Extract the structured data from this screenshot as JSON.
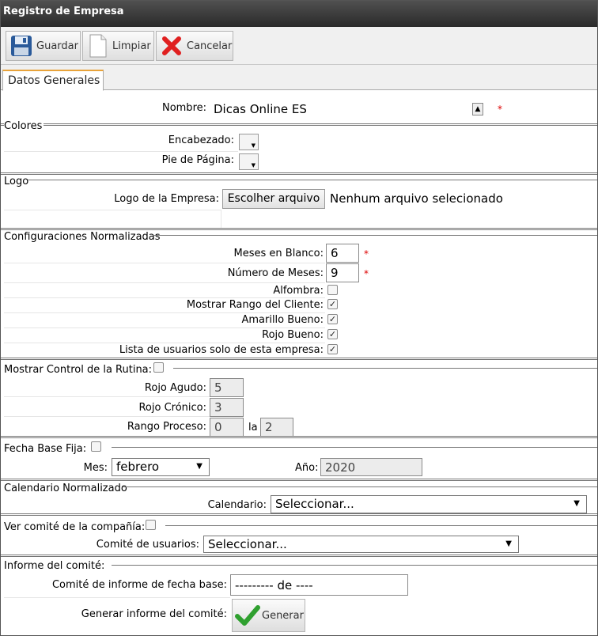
{
  "window": {
    "title": "Registro de Empresa"
  },
  "toolbar": {
    "save_label": "Guardar",
    "clear_label": "Limpiar",
    "cancel_label": "Cancelar"
  },
  "tabs": [
    {
      "label": "Datos Generales"
    }
  ],
  "nombre": {
    "label": "Nombre:",
    "value": "Dicas Online ES"
  },
  "colores": {
    "title": "Colores",
    "header_label": "Encabezado:",
    "footer_label": "Pie de Página:"
  },
  "logo": {
    "title": "Logo",
    "label": "Logo de la Empresa:",
    "button": "Escolher arquivo",
    "status": "Nenhum arquivo selecionado"
  },
  "config": {
    "title": "Configuraciones Normalizadas",
    "blank_months_label": "Meses en Blanco:",
    "blank_months_value": "6",
    "num_months_label": "Número de Meses:",
    "num_months_value": "9",
    "carpet_label": "Alfombra:",
    "client_range_label": "Mostrar Rango del Cliente:",
    "yellow_good_label": "Amarillo Bueno:",
    "red_good_label": "Rojo Bueno:",
    "company_users_label": "Lista de usuarios solo de esta empresa:"
  },
  "routine": {
    "title": "Mostrar Control de la Rutina:",
    "acute_label": "Rojo Agudo:",
    "acute_value": "5",
    "chronic_label": "Rojo Crónico:",
    "chronic_value": "3",
    "range_label": "Rango Proceso:",
    "range_from": "0",
    "range_sep": "la",
    "range_to": "2"
  },
  "base_date": {
    "title": "Fecha Base Fija:",
    "month_label": "Mes:",
    "month_value": "febrero",
    "year_label": "Año:",
    "year_value": "2020"
  },
  "calendar": {
    "title": "Calendario Normalizado",
    "label": "Calendario:",
    "value": "Seleccionar..."
  },
  "committee": {
    "title": "Ver comité de la compañía:",
    "label": "Comité de usuarios:",
    "value": "Seleccionar..."
  },
  "report": {
    "title": "Informe del comité:",
    "base_date_label": "Comité de informe de fecha base:",
    "base_date_value": "--------- de ----",
    "generate_label": "Generar informe del comité:",
    "generate_button": "Generar"
  },
  "required_marker": "*",
  "check_mark": "✓",
  "colors": {
    "accent": "#e8a33a",
    "required": "#dd0000",
    "save_icon": "#2a5a9a",
    "cancel_icon": "#e02020",
    "ok_icon": "#2fa02f"
  }
}
